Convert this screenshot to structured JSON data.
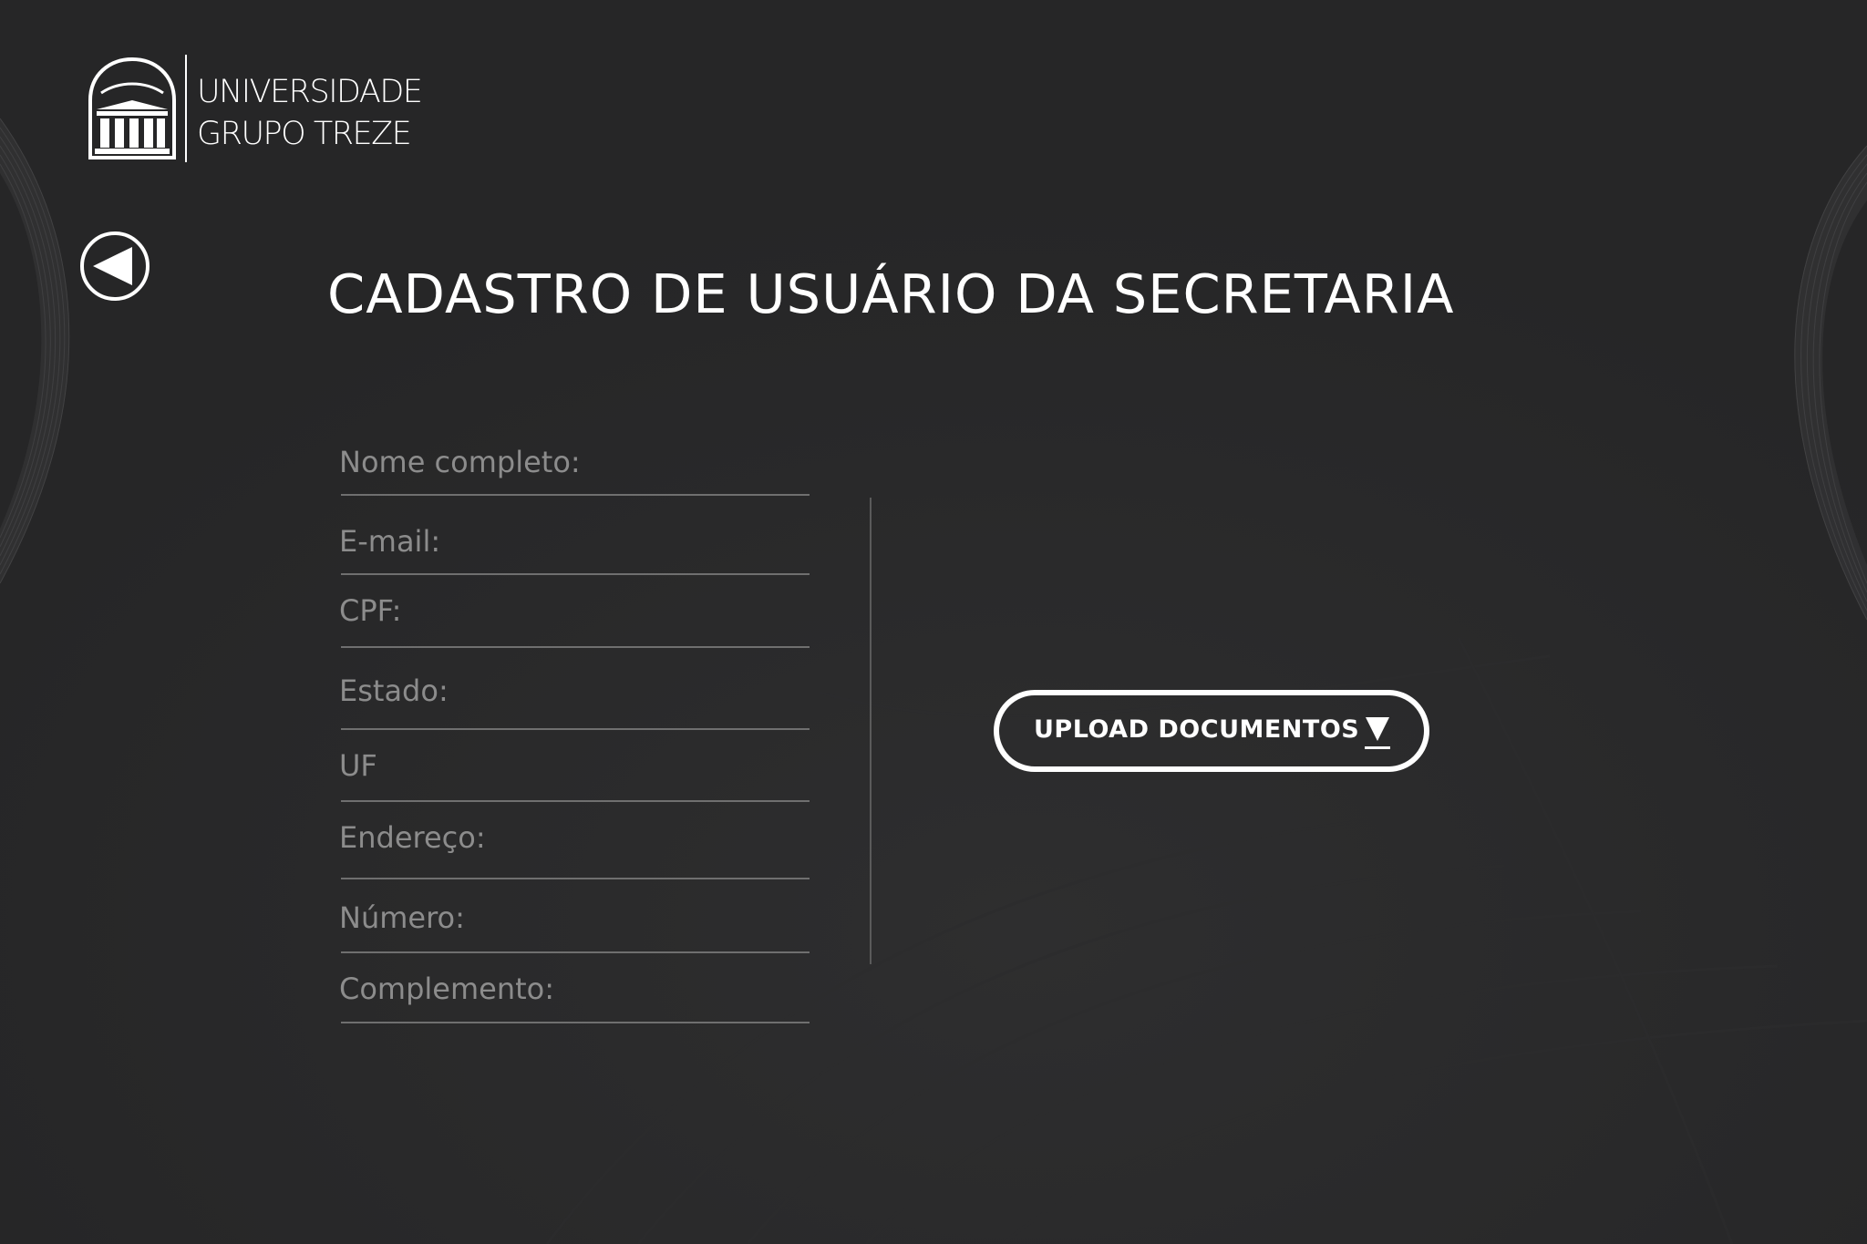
{
  "brand": {
    "line1": "UNIVERSIDADE",
    "line2": "GRUPO TREZE",
    "logo_icon": "building-icon"
  },
  "nav": {
    "back_icon": "back-arrow-icon"
  },
  "page": {
    "title": "CADASTRO DE USUÁRIO DA SECRETARIA"
  },
  "form": {
    "fields": [
      {
        "label": "Nome completo:",
        "value": ""
      },
      {
        "label": "E-mail:",
        "value": ""
      },
      {
        "label": "CPF:",
        "value": ""
      },
      {
        "label": "Estado:",
        "value": ""
      },
      {
        "label": "UF",
        "value": ""
      },
      {
        "label": "Endereço:",
        "value": ""
      },
      {
        "label": "Número:",
        "value": ""
      },
      {
        "label": "Complemento:",
        "value": ""
      }
    ]
  },
  "upload": {
    "label": "UPLOAD DOCUMENTOS",
    "icon": "download-arrow-icon"
  },
  "theme": {
    "background": "#262627",
    "text": "#ffffff",
    "field_label": "#8c8c8c",
    "field_line": "#6f6f6f"
  }
}
